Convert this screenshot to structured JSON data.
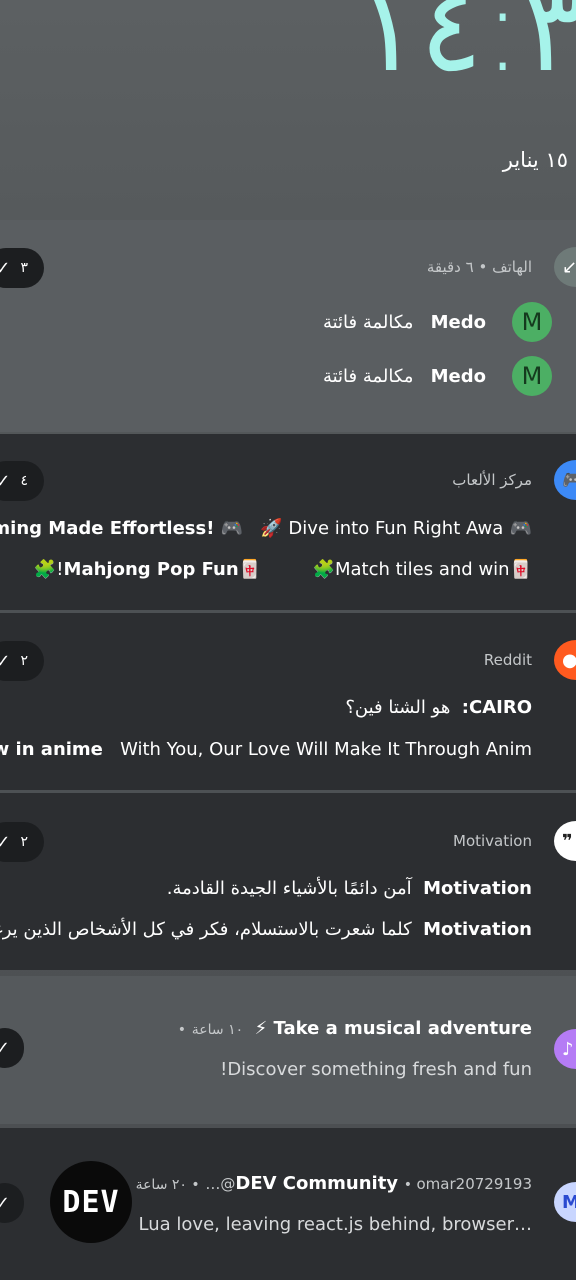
{
  "lockscreen": {
    "clock": "١٤:٣",
    "date": "١٥ يناير"
  },
  "notifications": [
    {
      "app": "الهاتف",
      "time": "٦ دقيقة",
      "count": "٣",
      "icon": "missed-call-icon",
      "color": "#6e7a78",
      "items": [
        {
          "title": "Medo",
          "text": "مكالمة فائتة",
          "avatar": "M"
        },
        {
          "title": "Medo",
          "text": "مكالمة فائتة",
          "avatar": "M"
        }
      ]
    },
    {
      "app": "مركز الألعاب",
      "count": "٤",
      "icon": "gamepad-icon",
      "color": "#3d8af7",
      "items": [
        {
          "title": "🎮 Gaming Made Effortless! 🎮",
          "text": "🚀 Dive into Fun Right Awa…"
        },
        {
          "title": "🀄Mahjong Pop Fun🀄",
          "text": "🧩Match tiles and win!🧩"
        }
      ]
    },
    {
      "app": "Reddit",
      "count": "٢",
      "icon": "reddit-icon",
      "color": "#ff5a1f",
      "items": [
        {
          "title": "CAIRO:",
          "text": "هو الشتا فين؟"
        },
        {
          "title": "Now in anime",
          "text": "With You, Our Love Will Make It Through Anim…"
        }
      ]
    },
    {
      "app": "Motivation",
      "count": "٢",
      "icon": "quote-icon",
      "color": "#ffffff",
      "items": [
        {
          "title": "Motivation",
          "text": "آمن دائمًا بالأشياء الجيدة القادمة."
        },
        {
          "title": "Motivation",
          "text": "كلما شعرت بالاستسلام، فكر في كل الأشخاص الذين يرغبون في"
        }
      ]
    },
    {
      "title": "Take a musical adventure ⚡",
      "time": "١٠ ساعة",
      "body": "Discover something fresh and fun!",
      "icon": "tiktok-icon",
      "color": "#b57cf5"
    },
    {
      "app": "DEV Community",
      "account": "omar20729193@…",
      "time": "٢٠ ساعة",
      "body": "Lua love, leaving react.js behind, browser…",
      "icon": "gmail-icon",
      "color": "#c9d6ff",
      "logo": "DEV"
    }
  ]
}
